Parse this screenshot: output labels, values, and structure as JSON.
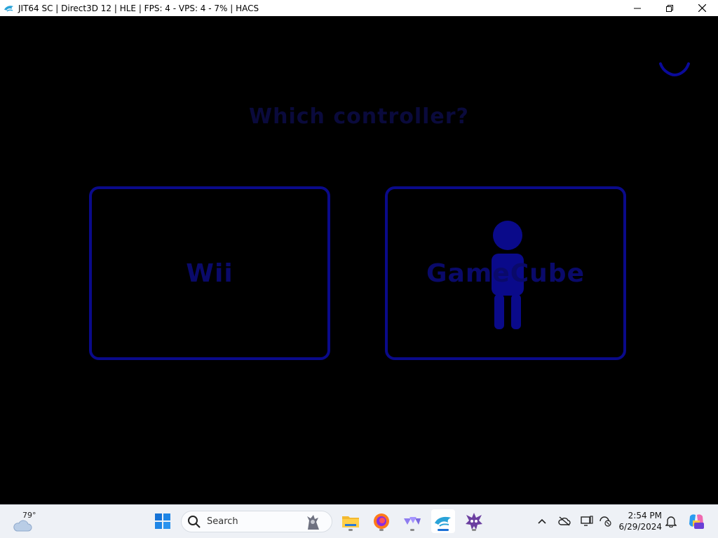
{
  "window": {
    "title": "JIT64 SC | Direct3D 12 | HLE | FPS: 4 - VPS: 4 - 7% | HACS",
    "icon": "dolphin-icon",
    "controls": [
      "minimize-icon",
      "maximize-icon",
      "close-icon"
    ]
  },
  "game": {
    "prompt": "Which controller?",
    "options": [
      {
        "label": "Wii",
        "icon": null
      },
      {
        "label": "GameCube",
        "icon": "person-figure-icon"
      }
    ],
    "colors": {
      "border": "#0a0a8a",
      "label": "#0a0a6a",
      "prompt": "#0a0a3c",
      "figure": "#0a0a8a"
    }
  },
  "taskbar": {
    "weather": {
      "temp": "79°",
      "icon": "cloud-icon"
    },
    "start_icon": "windows-start-icon",
    "search": {
      "placeholder": "Search"
    },
    "pinned": [
      {
        "name": "file-explorer-icon"
      },
      {
        "name": "firefox-icon"
      },
      {
        "name": "cemu-icon"
      },
      {
        "name": "dolphin-icon",
        "active": true
      },
      {
        "name": "game-app-icon"
      }
    ],
    "tray": [
      "chevron-up-icon",
      "onedrive-icon",
      "display-icon",
      "security-icon",
      "bell-icon",
      "copilot-icon"
    ],
    "clock": {
      "time": "2:54 PM",
      "date": "6/29/2024"
    }
  }
}
